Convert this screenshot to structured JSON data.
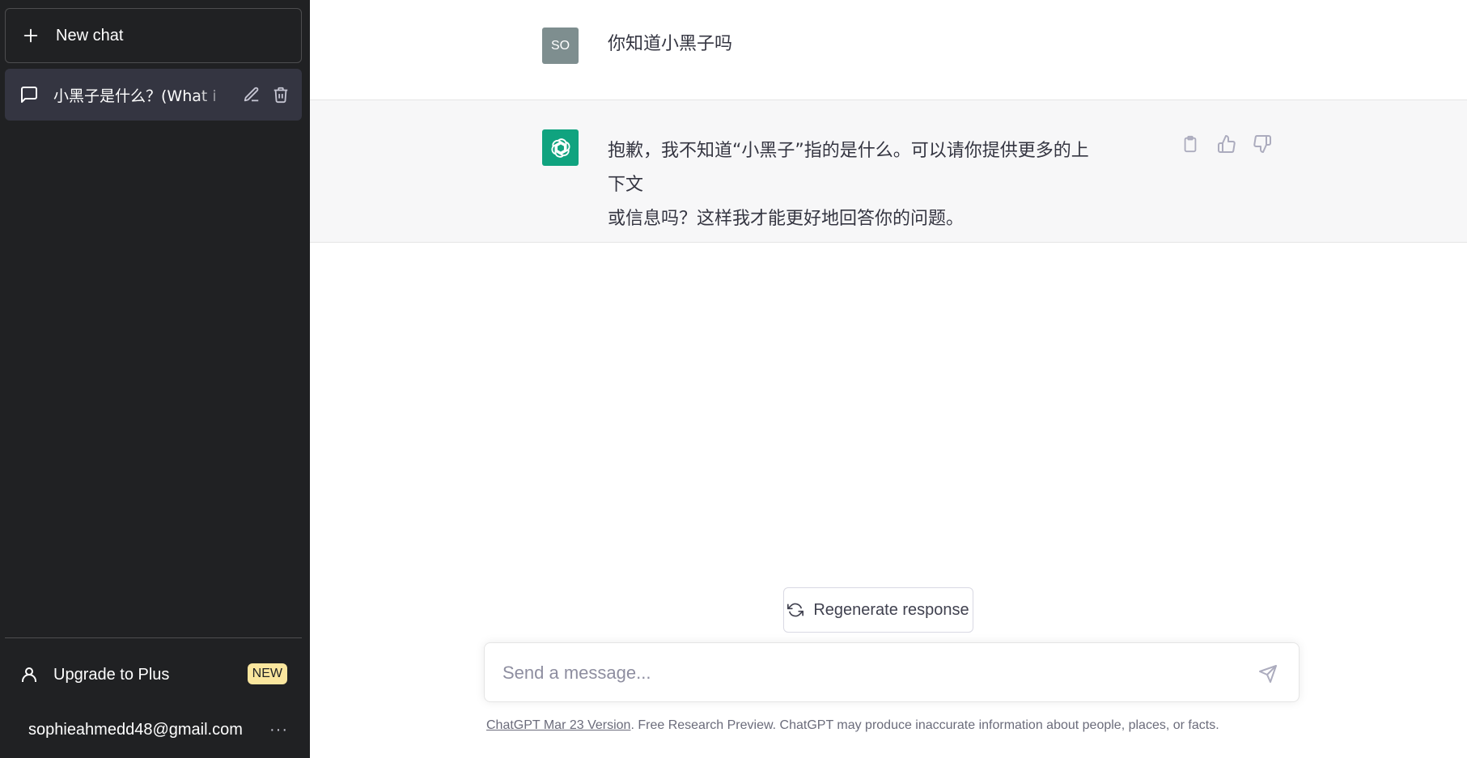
{
  "sidebar": {
    "new_chat_label": "New chat",
    "chat_items": [
      {
        "label": "小黑子是什么？(What i"
      }
    ],
    "upgrade_label": "Upgrade to Plus",
    "upgrade_badge": "NEW",
    "account_email": "sophieahmedd48@gmail.com",
    "account_more": "···"
  },
  "conversation": {
    "user": {
      "avatar_initials": "SO",
      "text": "你知道小黑子吗"
    },
    "assistant": {
      "text_line1": "抱歉，我不知道“小黑子”指的是什么。可以请你提供更多的上下文",
      "text_line2": "或信息吗？这样我才能更好地回答你的问题。"
    }
  },
  "composer": {
    "regenerate_label": "Regenerate response",
    "placeholder": "Send a message..."
  },
  "footer": {
    "version_link": "ChatGPT Mar 23 Version",
    "disclaimer": ". Free Research Preview. ChatGPT may produce inaccurate information about people, places, or facts."
  },
  "icons": {
    "new_chat": "plus-icon",
    "chat_item": "message-icon",
    "edit": "pencil-icon",
    "delete": "trash-icon",
    "upgrade": "user-icon",
    "copy": "clipboard-icon",
    "thumbs_up": "thumbs-up-icon",
    "thumbs_down": "thumbs-down-icon",
    "regenerate": "refresh-icon",
    "send": "send-icon",
    "gpt_logo": "openai-logo-icon"
  },
  "colors": {
    "sidebar_bg": "#202123",
    "active_item_bg": "#343541",
    "assistant_bg": "#f7f7f8",
    "gpt_avatar_bg": "#10a37f",
    "user_avatar_bg": "#7e8e8f",
    "badge_bg": "#fae69e"
  }
}
